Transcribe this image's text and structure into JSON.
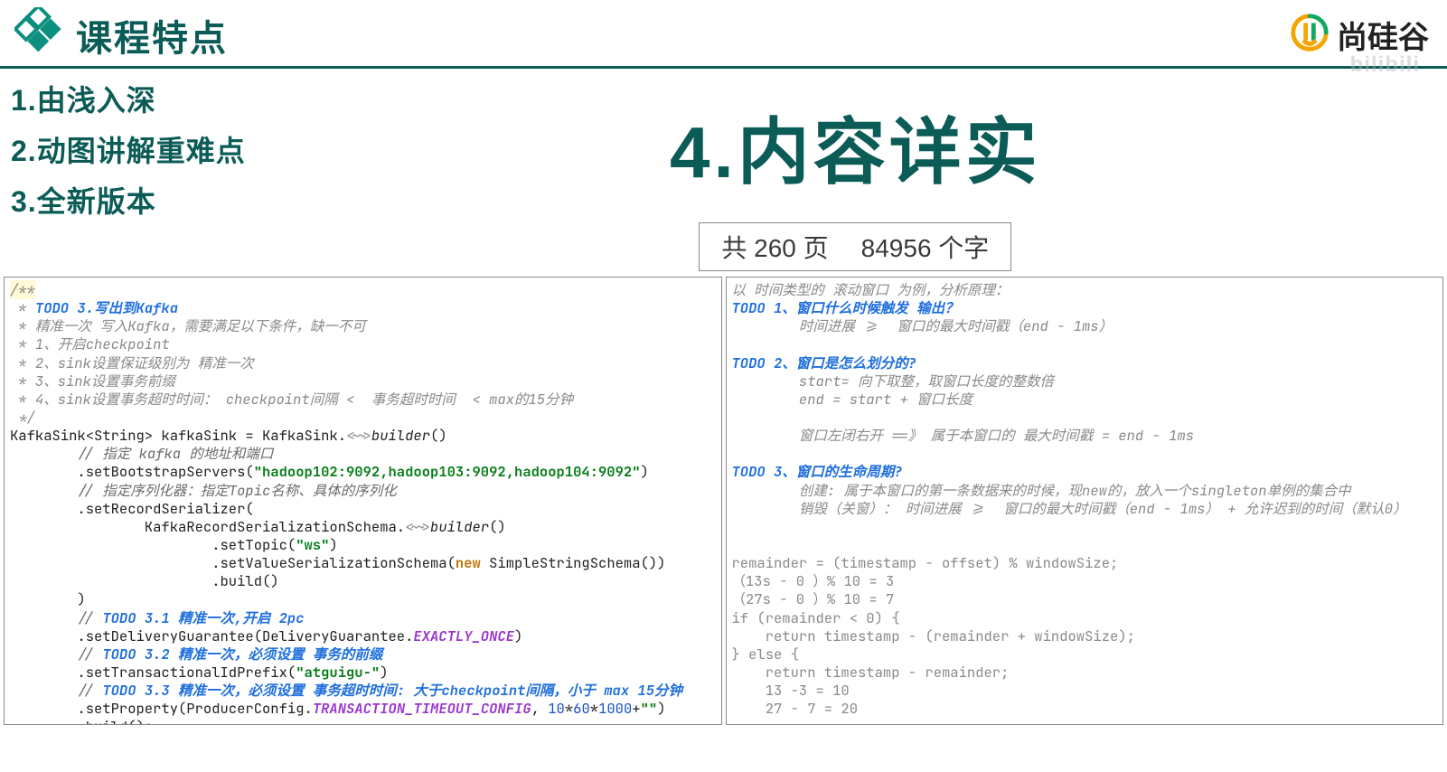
{
  "header": {
    "title": "课程特点",
    "logo_text": "尚硅谷"
  },
  "watermark": "bilibili",
  "features": {
    "items": [
      "1.由浅入深",
      "2.动图讲解重难点",
      "3.全新版本"
    ],
    "big": "4.内容详实"
  },
  "stats": {
    "pages": "共 260 页",
    "words": "84956 个字"
  },
  "code_left": {
    "l1": "/**",
    "l2_pre": " * ",
    "l2_todo": "TODO 3.写出到Kafka",
    "l3": " * 精准一次 写入Kafka，需要满足以下条件，缺一不可",
    "l4": " * 1、开启checkpoint",
    "l5": " * 2、sink设置保证级别为 精准一次",
    "l6": " * 3、sink设置事务前缀",
    "l7": " * 4、sink设置事务超时时间： checkpoint间隔 <  事务超时时间  < max的15分钟",
    "l8": " */",
    "l9a": "KafkaSink<String> kafkaSink = KafkaSink.",
    "l9b": "<~>",
    "l9c": "builder",
    "l9d": "()",
    "l10": "        // 指定 kafka 的地址和端口",
    "l11a": "        .setBootstrapServers(",
    "l11b": "\"hadoop102:9092,hadoop103:9092,hadoop104:9092\"",
    "l11c": ")",
    "l12": "        // 指定序列化器：指定Topic名称、具体的序列化",
    "l13": "        .setRecordSerializer(",
    "l14a": "                KafkaRecordSerializationSchema.",
    "l14b": "<~>",
    "l14c": "builder",
    "l14d": "()",
    "l15a": "                        .setTopic(",
    "l15b": "\"ws\"",
    "l15c": ")",
    "l16a": "                        .setValueSerializationSchema(",
    "l16b": "new",
    "l16c": " SimpleStringSchema())",
    "l17": "                        .build()",
    "l18": "        )",
    "l19a": "        // ",
    "l19b": "TODO 3.1 精准一次,开启 2pc",
    "l20a": "        .setDeliveryGuarantee(DeliveryGuarantee.",
    "l20b": "EXACTLY_ONCE",
    "l20c": ")",
    "l21a": "        // ",
    "l21b": "TODO 3.2 精准一次，必须设置 事务的前缀",
    "l22a": "        .setTransactionalIdPrefix(",
    "l22b": "\"atguigu-\"",
    "l22c": ")",
    "l23a": "        // ",
    "l23b": "TODO 3.3 精准一次，必须设置 事务超时时间: 大于checkpoint间隔，小于 max 15分钟",
    "l24a": "        .setProperty(ProducerConfig.",
    "l24b": "TRANSACTION_TIMEOUT_CONFIG",
    "l24c": ", ",
    "l24d": "10",
    "l24e": "*",
    "l24f": "60",
    "l24g": "*",
    "l24h": "1000",
    "l24i": "+",
    "l24j": "\"\"",
    "l24k": ")",
    "l25": "        .build();"
  },
  "code_right": {
    "r1": "以 时间类型的 滚动窗口 为例，分析原理：",
    "r2": "TODO 1、窗口什么时候触发 输出？",
    "r3": "        时间进展 >=  窗口的最大时间戳（end - 1ms）",
    "r4": "TODO 2、窗口是怎么划分的?",
    "r5": "        start= 向下取整，取窗口长度的整数倍",
    "r6": "        end = start + 窗口长度",
    "r7": "        窗口左闭右开 ==》 属于本窗口的 最大时间戳 = end - 1ms",
    "r8": "TODO 3、窗口的生命周期?",
    "r9": "        创建: 属于本窗口的第一条数据来的时候，现new的，放入一个singleton单例的集合中",
    "r10": "        销毁（关窗）： 时间进展 >=  窗口的最大时间戳（end - 1ms） + 允许迟到的时间（默认0）",
    "r11": "remainder = (timestamp - offset) % windowSize;",
    "r12": "（13s - 0 ）% 10 = 3",
    "r13": "（27s - 0 ）% 10 = 7",
    "r14": "if (remainder < 0) {",
    "r15": "    return timestamp - (remainder + windowSize);",
    "r16": "} else {",
    "r17": "    return timestamp - remainder;",
    "r18": "    13 -3 = 10",
    "r19": "    27 - 7 = 20"
  }
}
